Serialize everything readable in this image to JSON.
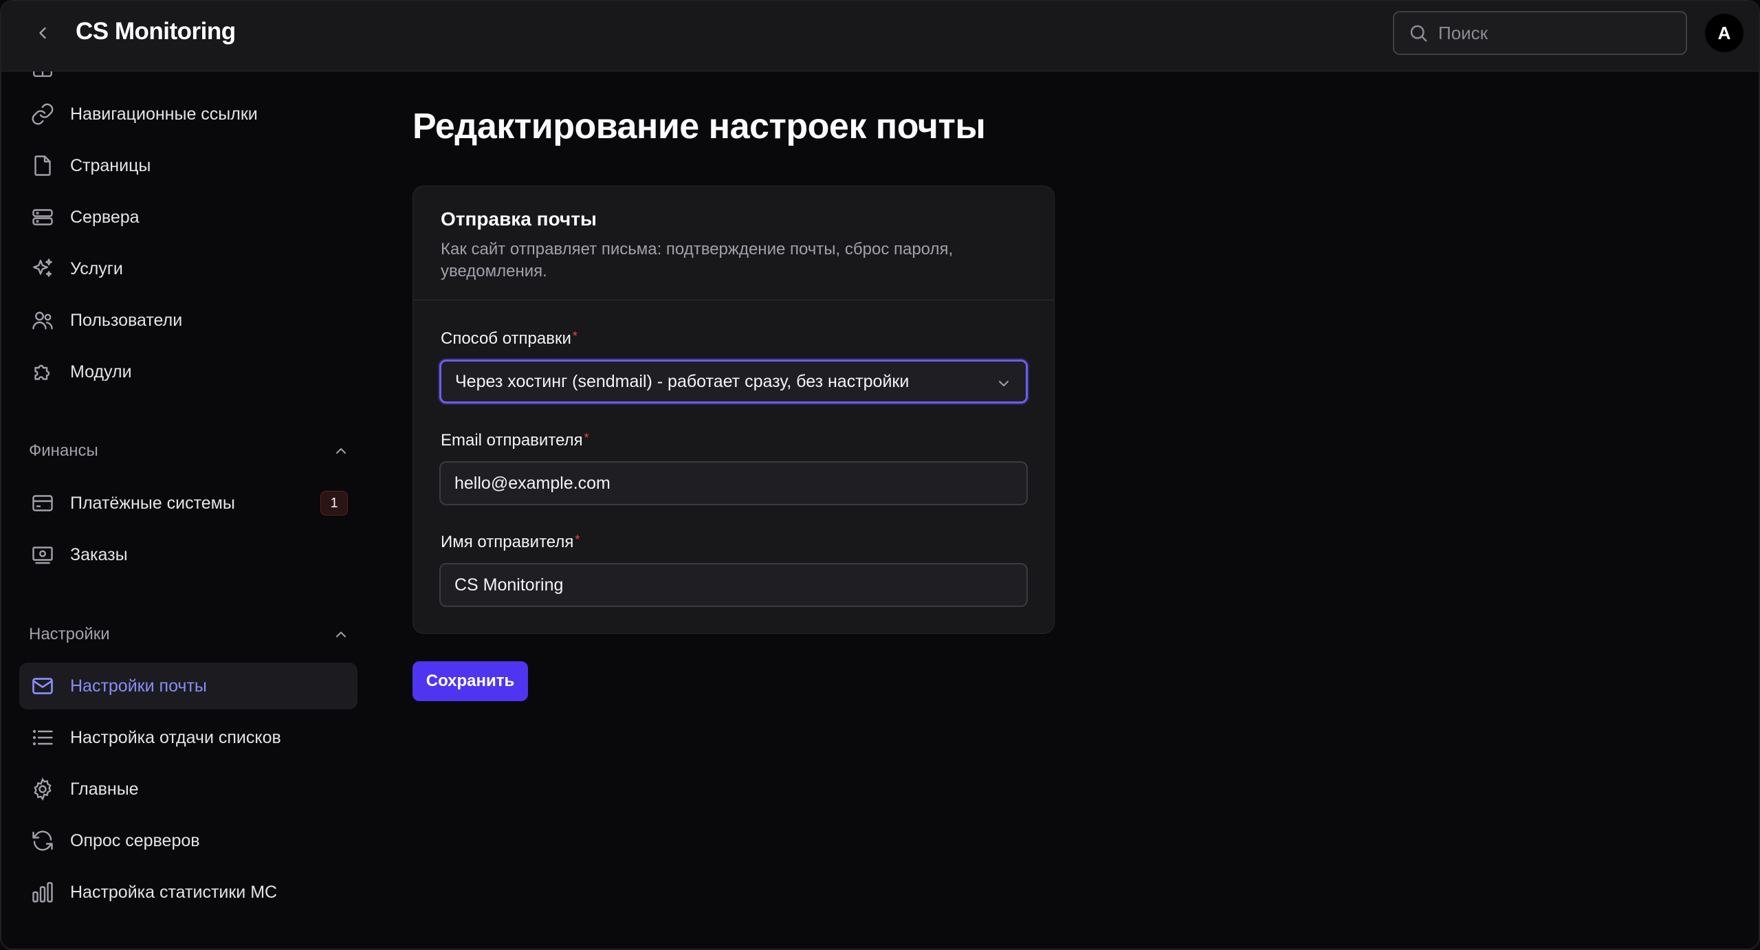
{
  "header": {
    "app_title": "CS Monitoring",
    "search_placeholder": "Поиск",
    "avatar_initial": "A"
  },
  "sidebar": {
    "items_top": [
      {
        "label": "Навигационные ссылки",
        "icon": "link-icon"
      },
      {
        "label": "Страницы",
        "icon": "file-icon"
      },
      {
        "label": "Сервера",
        "icon": "server-icon"
      },
      {
        "label": "Услуги",
        "icon": "sparkles-icon"
      },
      {
        "label": "Пользователи",
        "icon": "users-icon"
      },
      {
        "label": "Модули",
        "icon": "puzzle-icon"
      }
    ],
    "finance_group": {
      "label": "Финансы",
      "items": [
        {
          "label": "Платёжные системы",
          "icon": "credit-card-icon",
          "badge": "1"
        },
        {
          "label": "Заказы",
          "icon": "banknote-icon"
        }
      ]
    },
    "settings_group": {
      "label": "Настройки",
      "items": [
        {
          "label": "Настройки почты",
          "icon": "mail-icon",
          "active": true
        },
        {
          "label": "Настройка отдачи списков",
          "icon": "list-icon"
        },
        {
          "label": "Главные",
          "icon": "gear-icon"
        },
        {
          "label": "Опрос серверов",
          "icon": "refresh-icon"
        },
        {
          "label": "Настройка статистики МС",
          "icon": "bar-chart-icon"
        }
      ]
    }
  },
  "main": {
    "page_title": "Редактирование настроек почты",
    "card": {
      "title": "Отправка почты",
      "description": "Как сайт отправляет письма: подтверждение почты, сброс пароля, уведомления.",
      "fields": {
        "method": {
          "label": "Способ отправки",
          "value": "Через хостинг (sendmail) - работает сразу, без настройки"
        },
        "email": {
          "label": "Email отправителя",
          "value": "hello@example.com"
        },
        "name": {
          "label": "Имя отправителя",
          "value": "CS Monitoring"
        }
      }
    },
    "save_label": "Сохранить"
  },
  "colors": {
    "accent": "#4f35f2",
    "active_text": "#8b8cf8",
    "background": "#09090b",
    "card": "#18181b"
  }
}
